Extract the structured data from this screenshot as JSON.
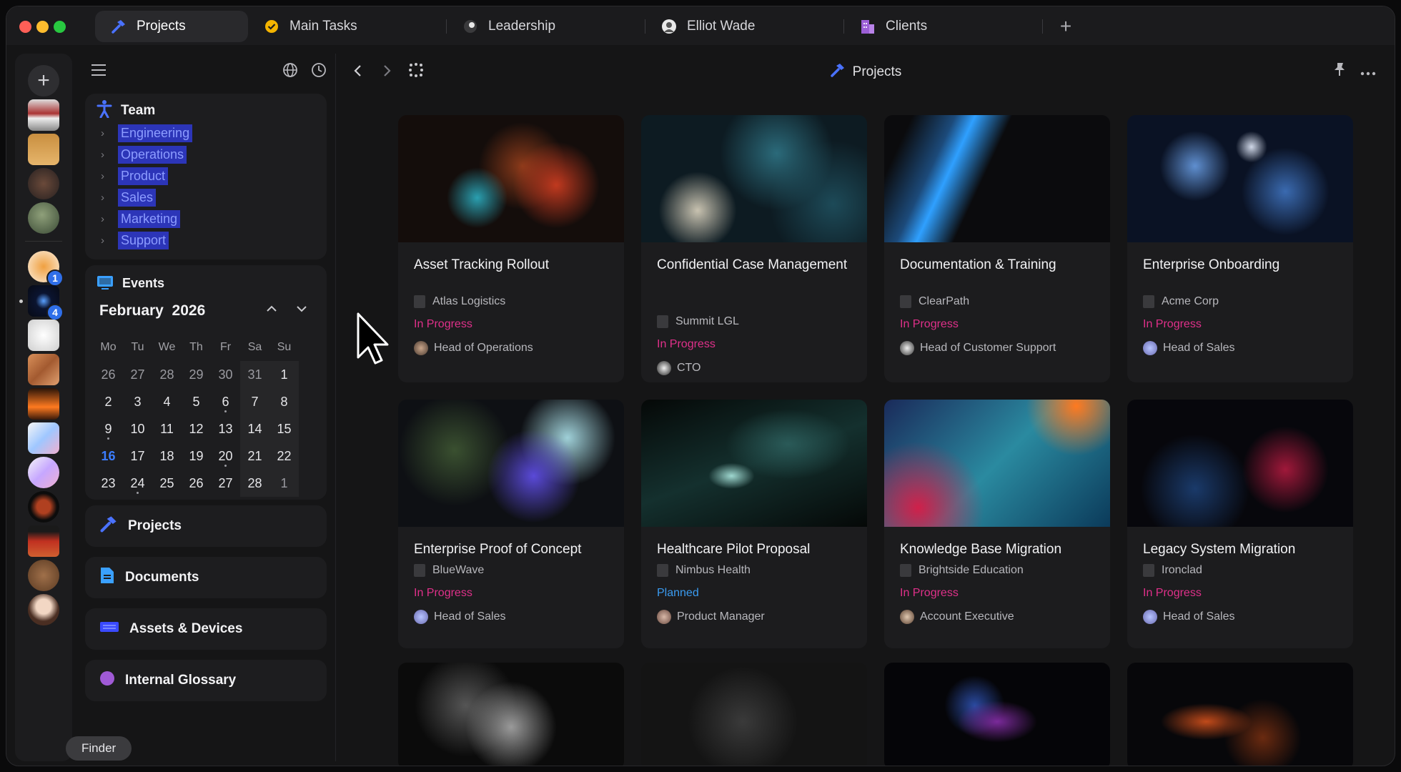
{
  "window": {
    "tabs": [
      {
        "label": "Projects",
        "icon": "hammer-icon",
        "active": true
      },
      {
        "label": "Main Tasks",
        "icon": "check-circle-icon"
      },
      {
        "label": "Leadership",
        "icon": "eight-ball-icon"
      },
      {
        "label": "Elliot Wade",
        "icon": "person-avatar-icon"
      },
      {
        "label": "Clients",
        "icon": "building-icon"
      }
    ],
    "new_tab_label": "+"
  },
  "dock": {
    "add_label": "+",
    "badges": {
      "first": "1",
      "second": "4"
    },
    "tooltip": "Finder"
  },
  "sidebar": {
    "team": {
      "title": "Team",
      "items": [
        "Engineering",
        "Operations",
        "Product",
        "Sales",
        "Marketing",
        "Support"
      ]
    },
    "events": {
      "title": "Events",
      "month": "February",
      "year": "2026",
      "weekdays": [
        "Mo",
        "Tu",
        "We",
        "Th",
        "Fr",
        "Sa",
        "Su"
      ],
      "weeks": [
        [
          "26",
          "27",
          "28",
          "29",
          "30",
          "31",
          "1"
        ],
        [
          "2",
          "3",
          "4",
          "5",
          "6",
          "7",
          "8"
        ],
        [
          "9",
          "10",
          "11",
          "12",
          "13",
          "14",
          "15"
        ],
        [
          "16",
          "17",
          "18",
          "19",
          "20",
          "21",
          "22"
        ],
        [
          "23",
          "24",
          "25",
          "26",
          "27",
          "28",
          "1"
        ]
      ],
      "today": "16"
    },
    "nav": [
      {
        "label": "Projects",
        "icon": "hammer-icon"
      },
      {
        "label": "Documents",
        "icon": "document-icon"
      },
      {
        "label": "Assets & Devices",
        "icon": "keyboard-icon"
      },
      {
        "label": "Internal Glossary",
        "icon": "book-icon"
      }
    ]
  },
  "main": {
    "title": "Projects",
    "cards": [
      {
        "title": "Asset Tracking Rollout",
        "client": "Atlas Logistics",
        "status": "In Progress",
        "owner": "Head of Operations"
      },
      {
        "title": "Confidential Case Management",
        "client": "Summit LGL",
        "status": "In Progress",
        "owner": "CTO"
      },
      {
        "title": "Documentation & Training",
        "client": "ClearPath",
        "status": "In Progress",
        "owner": "Head of Customer Support"
      },
      {
        "title": "Enterprise Onboarding",
        "client": "Acme Corp",
        "status": "In Progress",
        "owner": "Head of Sales"
      },
      {
        "title": "Enterprise Proof of Concept",
        "client": "BlueWave",
        "status": "In Progress",
        "owner": "Head of Sales"
      },
      {
        "title": "Healthcare Pilot Proposal",
        "client": "Nimbus Health",
        "status": "Planned",
        "owner": "Product Manager"
      },
      {
        "title": "Knowledge Base Migration",
        "client": "Brightside Education",
        "status": "In Progress",
        "owner": "Account Executive"
      },
      {
        "title": "Legacy System Migration",
        "client": "Ironclad",
        "status": "In Progress",
        "owner": "Head of Sales"
      }
    ]
  },
  "colors": {
    "in_progress": "#e0308a",
    "planned": "#3a9bf0",
    "accent": "#3b7dff",
    "team_highlight": "#2c35b8"
  }
}
